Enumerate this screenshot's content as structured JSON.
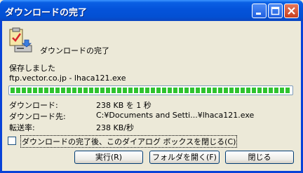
{
  "window": {
    "title": "ダウンロードの完了"
  },
  "icon": {
    "name": "download-complete-icon"
  },
  "header": {
    "label": "ダウンロードの完了"
  },
  "status": {
    "saved_label": "保存しました",
    "file_source": "ftp.vector.co.jp - lhaca121.exe"
  },
  "progress": {
    "percent": 100
  },
  "details": [
    {
      "label": "ダウンロード:",
      "value": "238 KB を 1 秒"
    },
    {
      "label": "ダウンロード先:",
      "value": "C:¥Documents and Setti...¥lhaca121.exe"
    },
    {
      "label": "転送率:",
      "value": "238 KB/秒"
    }
  ],
  "checkbox": {
    "label": "ダウンロードの完了後、このダイアログ ボックスを閉じる(C)",
    "checked": false
  },
  "buttons": {
    "run": "実行(R)",
    "open_folder": "フォルダを開く(F)",
    "close": "閉じる"
  }
}
